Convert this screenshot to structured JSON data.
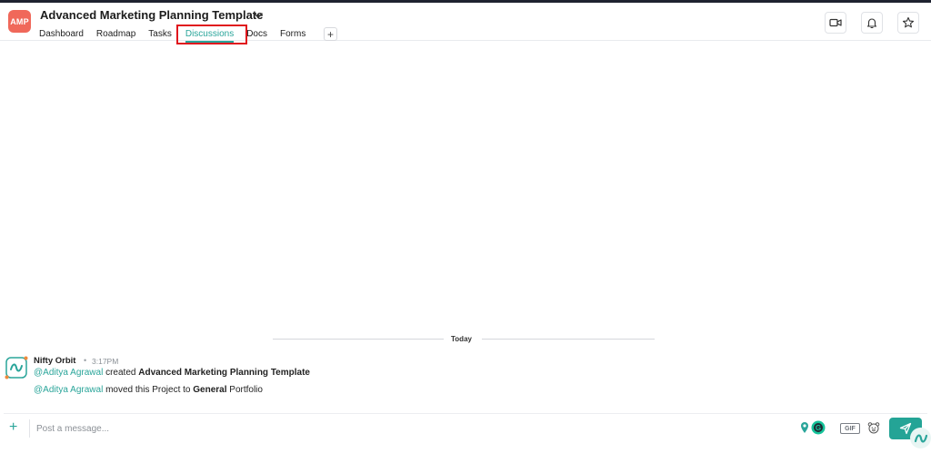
{
  "project": {
    "badge": "AMP",
    "title": "Advanced Marketing Planning Template"
  },
  "tabs": [
    {
      "label": "Dashboard"
    },
    {
      "label": "Roadmap"
    },
    {
      "label": "Tasks"
    },
    {
      "label": "Discussions",
      "active": true
    },
    {
      "label": "Docs"
    },
    {
      "label": "Forms"
    }
  ],
  "tab_add_label": "+",
  "header_actions": [
    "video-call-icon",
    "bell-icon",
    "star-icon"
  ],
  "feed": {
    "date_divider": "Today",
    "message": {
      "author": "Nifty Orbit",
      "separator": "•",
      "time": "3:17PM",
      "lines": [
        {
          "mention": "@Aditya Agrawal",
          "text": " created ",
          "bold": "Advanced Marketing Planning Template",
          "tail": ""
        },
        {
          "mention": "@Aditya Agrawal",
          "text": " moved this Project to ",
          "bold": "General",
          "tail": " Portfolio"
        }
      ]
    }
  },
  "composer": {
    "add_label": "+",
    "placeholder": "Post a message...",
    "value": "",
    "gif_label": "GIF",
    "grammarly_letter": "G"
  },
  "colors": {
    "accent": "#2aa59a",
    "badge": "#f0685a",
    "highlight": "#e0161d",
    "send": "#24a496"
  }
}
